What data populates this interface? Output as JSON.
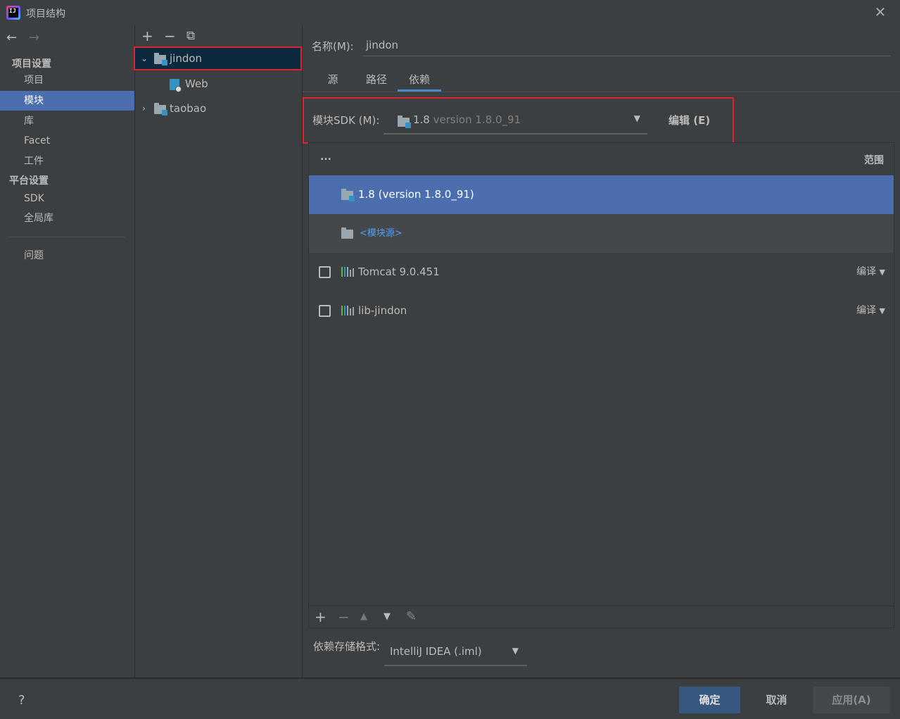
{
  "window": {
    "title": "项目结构",
    "close_glyph": "✕"
  },
  "nav": {
    "back": "←",
    "forward": "→",
    "project_settings_heading": "项目设置",
    "platform_settings_heading": "平台设置",
    "items": [
      {
        "label": "项目"
      },
      {
        "label": "模块",
        "selected": true
      },
      {
        "label": "库"
      },
      {
        "label": "Facet"
      },
      {
        "label": "工件"
      }
    ],
    "platform_items": [
      {
        "label": "SDK"
      },
      {
        "label": "全局库"
      }
    ],
    "problems": "问题"
  },
  "tree": {
    "toolbar": {
      "add": "+",
      "remove": "−",
      "copy": "⧉"
    },
    "nodes": [
      {
        "label": "jindon",
        "expanded": true,
        "selected": true
      },
      {
        "label": "Web"
      },
      {
        "label": "taobao",
        "expanded": false
      }
    ]
  },
  "module": {
    "name_label": "名称(M):",
    "name_value": "jindon",
    "tabs": [
      {
        "label": "源"
      },
      {
        "label": "路径"
      },
      {
        "label": "依赖",
        "active": true
      }
    ],
    "sdk_label": "模块SDK (M):",
    "sdk_value": "1.8",
    "sdk_version": "version 1.8.0_91",
    "edit_label": "编辑 (E)"
  },
  "deps": {
    "header_more": "...",
    "header_scope": "范围",
    "rows": [
      {
        "label": "1.8 (version 1.8.0_91)",
        "type": "sdk"
      },
      {
        "label": "<模块源>",
        "type": "source"
      },
      {
        "label": "Tomcat 9.0.451",
        "scope": "编译",
        "type": "library"
      },
      {
        "label": "lib-jindon",
        "scope": "编译",
        "type": "library"
      }
    ],
    "toolbar": {
      "add": "+",
      "remove": "−",
      "up": "▲",
      "down": "▼",
      "edit": "✎"
    }
  },
  "storage": {
    "label": "依赖存储格式:",
    "value": "IntelliJ IDEA (.iml)"
  },
  "footer": {
    "help": "?",
    "ok": "确定",
    "cancel": "取消",
    "apply": "应用(A)"
  },
  "colors": {
    "background": "#3c3f41",
    "selection": "#4b6eaf",
    "tree_selection": "#0d293e",
    "highlight_border": "#e0242b",
    "link": "#589df6"
  }
}
